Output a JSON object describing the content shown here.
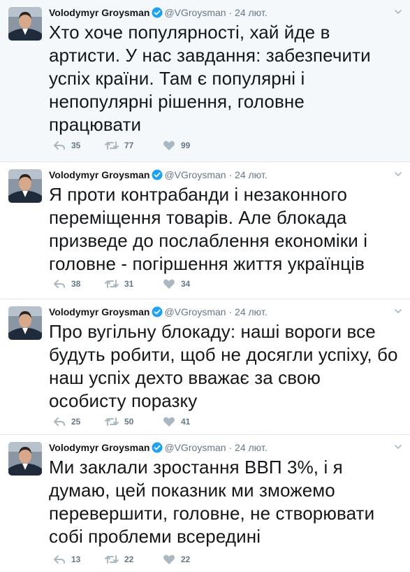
{
  "colors": {
    "text": "#14171a",
    "meta": "#657786",
    "verified": "#1da1f2",
    "highlight_bg": "#f5f8fa",
    "divider": "#e1e8ed"
  },
  "icons": {
    "reply": "reply-icon",
    "retweet": "retweet-icon",
    "like": "heart-icon",
    "verified": "verified-badge-icon",
    "more": "chevron-down-icon"
  },
  "tweets": [
    {
      "name": "Volodymyr Groysman",
      "handle": "@VGroysman",
      "dot": "·",
      "date": "24 лют.",
      "text": "Хто хоче популярності, хай йде в артисти. У нас завдання: забезпечити успіх країни. Там є популярні і непопулярні рішення, головне працювати",
      "replies": "35",
      "retweets": "77",
      "likes": "99"
    },
    {
      "name": "Volodymyr Groysman",
      "handle": "@VGroysman",
      "dot": "·",
      "date": "24 лют.",
      "text": "Я проти контрабанди і незаконного переміщення товарів. Але блокада призведе до послаблення економіки і головне - погіршення життя українців",
      "replies": "38",
      "retweets": "31",
      "likes": "34"
    },
    {
      "name": "Volodymyr Groysman",
      "handle": "@VGroysman",
      "dot": "·",
      "date": "24 лют.",
      "text": "Про вугільну блокаду: наші вороги все будуть робити, щоб не досягли успіху, бо наш успіх дехто вважає за свою особисту поразку",
      "replies": "25",
      "retweets": "50",
      "likes": "41"
    },
    {
      "name": "Volodymyr Groysman",
      "handle": "@VGroysman",
      "dot": "·",
      "date": "24 лют.",
      "text": "Ми заклали зростання ВВП 3%, і я думаю, цей показник ми зможемо перевершити, головне, не створювати собі проблеми всередині",
      "replies": "13",
      "retweets": "22",
      "likes": "22"
    }
  ]
}
